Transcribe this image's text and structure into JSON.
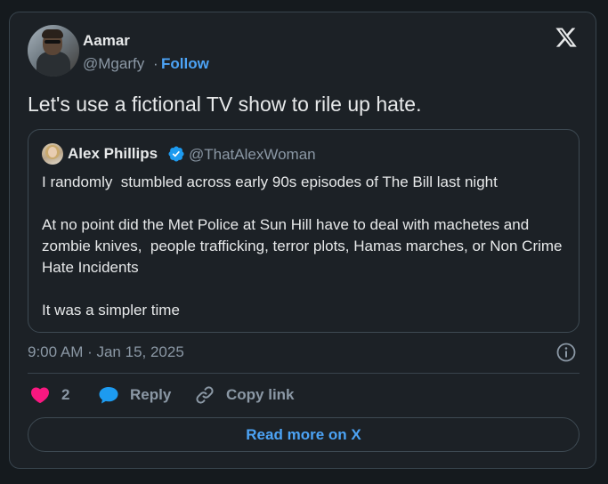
{
  "author": {
    "name": "Aamar",
    "handle": "@Mgarfy",
    "separator": "·",
    "follow_label": "Follow"
  },
  "tweet": {
    "text": "Let's use a fictional TV show to rile up hate."
  },
  "quoted": {
    "name": "Alex Phillips",
    "handle": "@ThatAlexWoman",
    "verified": true,
    "paragraphs": [
      "I randomly  stumbled across early 90s episodes of The Bill last night",
      "At no point did the Met Police at Sun Hill have to deal with machetes and zombie knives,  people trafficking, terror plots, Hamas marches, or Non Crime Hate Incidents",
      "It was a simpler time"
    ]
  },
  "meta": {
    "timestamp": "9:00 AM · Jan 15, 2025"
  },
  "actions": {
    "like_count": "2",
    "reply_label": "Reply",
    "copy_label": "Copy link"
  },
  "footer": {
    "read_more_label": "Read more on X"
  },
  "colors": {
    "accent": "#4ca3f5",
    "like": "#f91880",
    "reply_icon": "#1d9bf0",
    "verified": "#1d9bf0"
  },
  "icons": [
    "x-logo-icon",
    "verified-badge-icon",
    "info-icon",
    "heart-icon",
    "reply-bubble-icon",
    "link-icon"
  ]
}
